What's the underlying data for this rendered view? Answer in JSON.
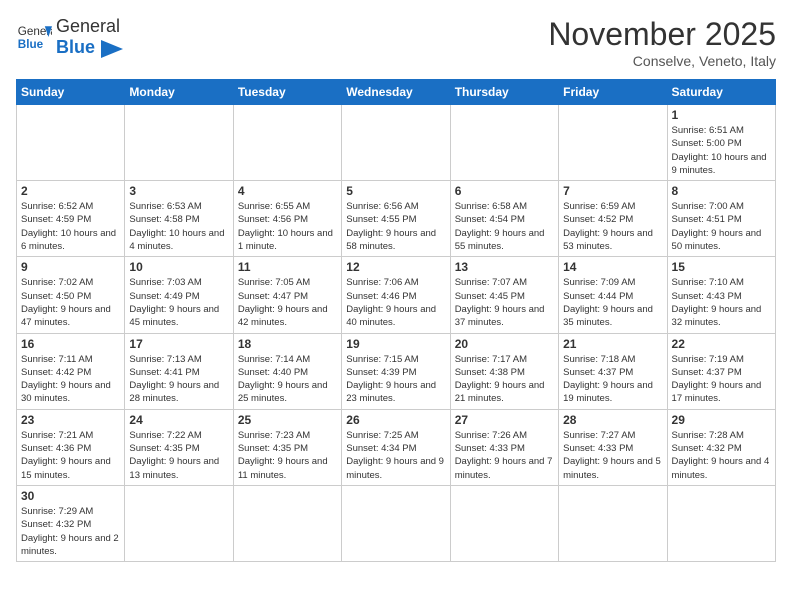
{
  "header": {
    "logo_general": "General",
    "logo_blue": "Blue",
    "month_title": "November 2025",
    "location": "Conselve, Veneto, Italy"
  },
  "weekdays": [
    "Sunday",
    "Monday",
    "Tuesday",
    "Wednesday",
    "Thursday",
    "Friday",
    "Saturday"
  ],
  "weeks": [
    [
      {
        "day": "",
        "info": ""
      },
      {
        "day": "",
        "info": ""
      },
      {
        "day": "",
        "info": ""
      },
      {
        "day": "",
        "info": ""
      },
      {
        "day": "",
        "info": ""
      },
      {
        "day": "",
        "info": ""
      },
      {
        "day": "1",
        "info": "Sunrise: 6:51 AM\nSunset: 5:00 PM\nDaylight: 10 hours and 9 minutes."
      }
    ],
    [
      {
        "day": "2",
        "info": "Sunrise: 6:52 AM\nSunset: 4:59 PM\nDaylight: 10 hours and 6 minutes."
      },
      {
        "day": "3",
        "info": "Sunrise: 6:53 AM\nSunset: 4:58 PM\nDaylight: 10 hours and 4 minutes."
      },
      {
        "day": "4",
        "info": "Sunrise: 6:55 AM\nSunset: 4:56 PM\nDaylight: 10 hours and 1 minute."
      },
      {
        "day": "5",
        "info": "Sunrise: 6:56 AM\nSunset: 4:55 PM\nDaylight: 9 hours and 58 minutes."
      },
      {
        "day": "6",
        "info": "Sunrise: 6:58 AM\nSunset: 4:54 PM\nDaylight: 9 hours and 55 minutes."
      },
      {
        "day": "7",
        "info": "Sunrise: 6:59 AM\nSunset: 4:52 PM\nDaylight: 9 hours and 53 minutes."
      },
      {
        "day": "8",
        "info": "Sunrise: 7:00 AM\nSunset: 4:51 PM\nDaylight: 9 hours and 50 minutes."
      }
    ],
    [
      {
        "day": "9",
        "info": "Sunrise: 7:02 AM\nSunset: 4:50 PM\nDaylight: 9 hours and 47 minutes."
      },
      {
        "day": "10",
        "info": "Sunrise: 7:03 AM\nSunset: 4:49 PM\nDaylight: 9 hours and 45 minutes."
      },
      {
        "day": "11",
        "info": "Sunrise: 7:05 AM\nSunset: 4:47 PM\nDaylight: 9 hours and 42 minutes."
      },
      {
        "day": "12",
        "info": "Sunrise: 7:06 AM\nSunset: 4:46 PM\nDaylight: 9 hours and 40 minutes."
      },
      {
        "day": "13",
        "info": "Sunrise: 7:07 AM\nSunset: 4:45 PM\nDaylight: 9 hours and 37 minutes."
      },
      {
        "day": "14",
        "info": "Sunrise: 7:09 AM\nSunset: 4:44 PM\nDaylight: 9 hours and 35 minutes."
      },
      {
        "day": "15",
        "info": "Sunrise: 7:10 AM\nSunset: 4:43 PM\nDaylight: 9 hours and 32 minutes."
      }
    ],
    [
      {
        "day": "16",
        "info": "Sunrise: 7:11 AM\nSunset: 4:42 PM\nDaylight: 9 hours and 30 minutes."
      },
      {
        "day": "17",
        "info": "Sunrise: 7:13 AM\nSunset: 4:41 PM\nDaylight: 9 hours and 28 minutes."
      },
      {
        "day": "18",
        "info": "Sunrise: 7:14 AM\nSunset: 4:40 PM\nDaylight: 9 hours and 25 minutes."
      },
      {
        "day": "19",
        "info": "Sunrise: 7:15 AM\nSunset: 4:39 PM\nDaylight: 9 hours and 23 minutes."
      },
      {
        "day": "20",
        "info": "Sunrise: 7:17 AM\nSunset: 4:38 PM\nDaylight: 9 hours and 21 minutes."
      },
      {
        "day": "21",
        "info": "Sunrise: 7:18 AM\nSunset: 4:37 PM\nDaylight: 9 hours and 19 minutes."
      },
      {
        "day": "22",
        "info": "Sunrise: 7:19 AM\nSunset: 4:37 PM\nDaylight: 9 hours and 17 minutes."
      }
    ],
    [
      {
        "day": "23",
        "info": "Sunrise: 7:21 AM\nSunset: 4:36 PM\nDaylight: 9 hours and 15 minutes."
      },
      {
        "day": "24",
        "info": "Sunrise: 7:22 AM\nSunset: 4:35 PM\nDaylight: 9 hours and 13 minutes."
      },
      {
        "day": "25",
        "info": "Sunrise: 7:23 AM\nSunset: 4:35 PM\nDaylight: 9 hours and 11 minutes."
      },
      {
        "day": "26",
        "info": "Sunrise: 7:25 AM\nSunset: 4:34 PM\nDaylight: 9 hours and 9 minutes."
      },
      {
        "day": "27",
        "info": "Sunrise: 7:26 AM\nSunset: 4:33 PM\nDaylight: 9 hours and 7 minutes."
      },
      {
        "day": "28",
        "info": "Sunrise: 7:27 AM\nSunset: 4:33 PM\nDaylight: 9 hours and 5 minutes."
      },
      {
        "day": "29",
        "info": "Sunrise: 7:28 AM\nSunset: 4:32 PM\nDaylight: 9 hours and 4 minutes."
      }
    ],
    [
      {
        "day": "30",
        "info": "Sunrise: 7:29 AM\nSunset: 4:32 PM\nDaylight: 9 hours and 2 minutes."
      },
      {
        "day": "",
        "info": ""
      },
      {
        "day": "",
        "info": ""
      },
      {
        "day": "",
        "info": ""
      },
      {
        "day": "",
        "info": ""
      },
      {
        "day": "",
        "info": ""
      },
      {
        "day": "",
        "info": ""
      }
    ]
  ]
}
